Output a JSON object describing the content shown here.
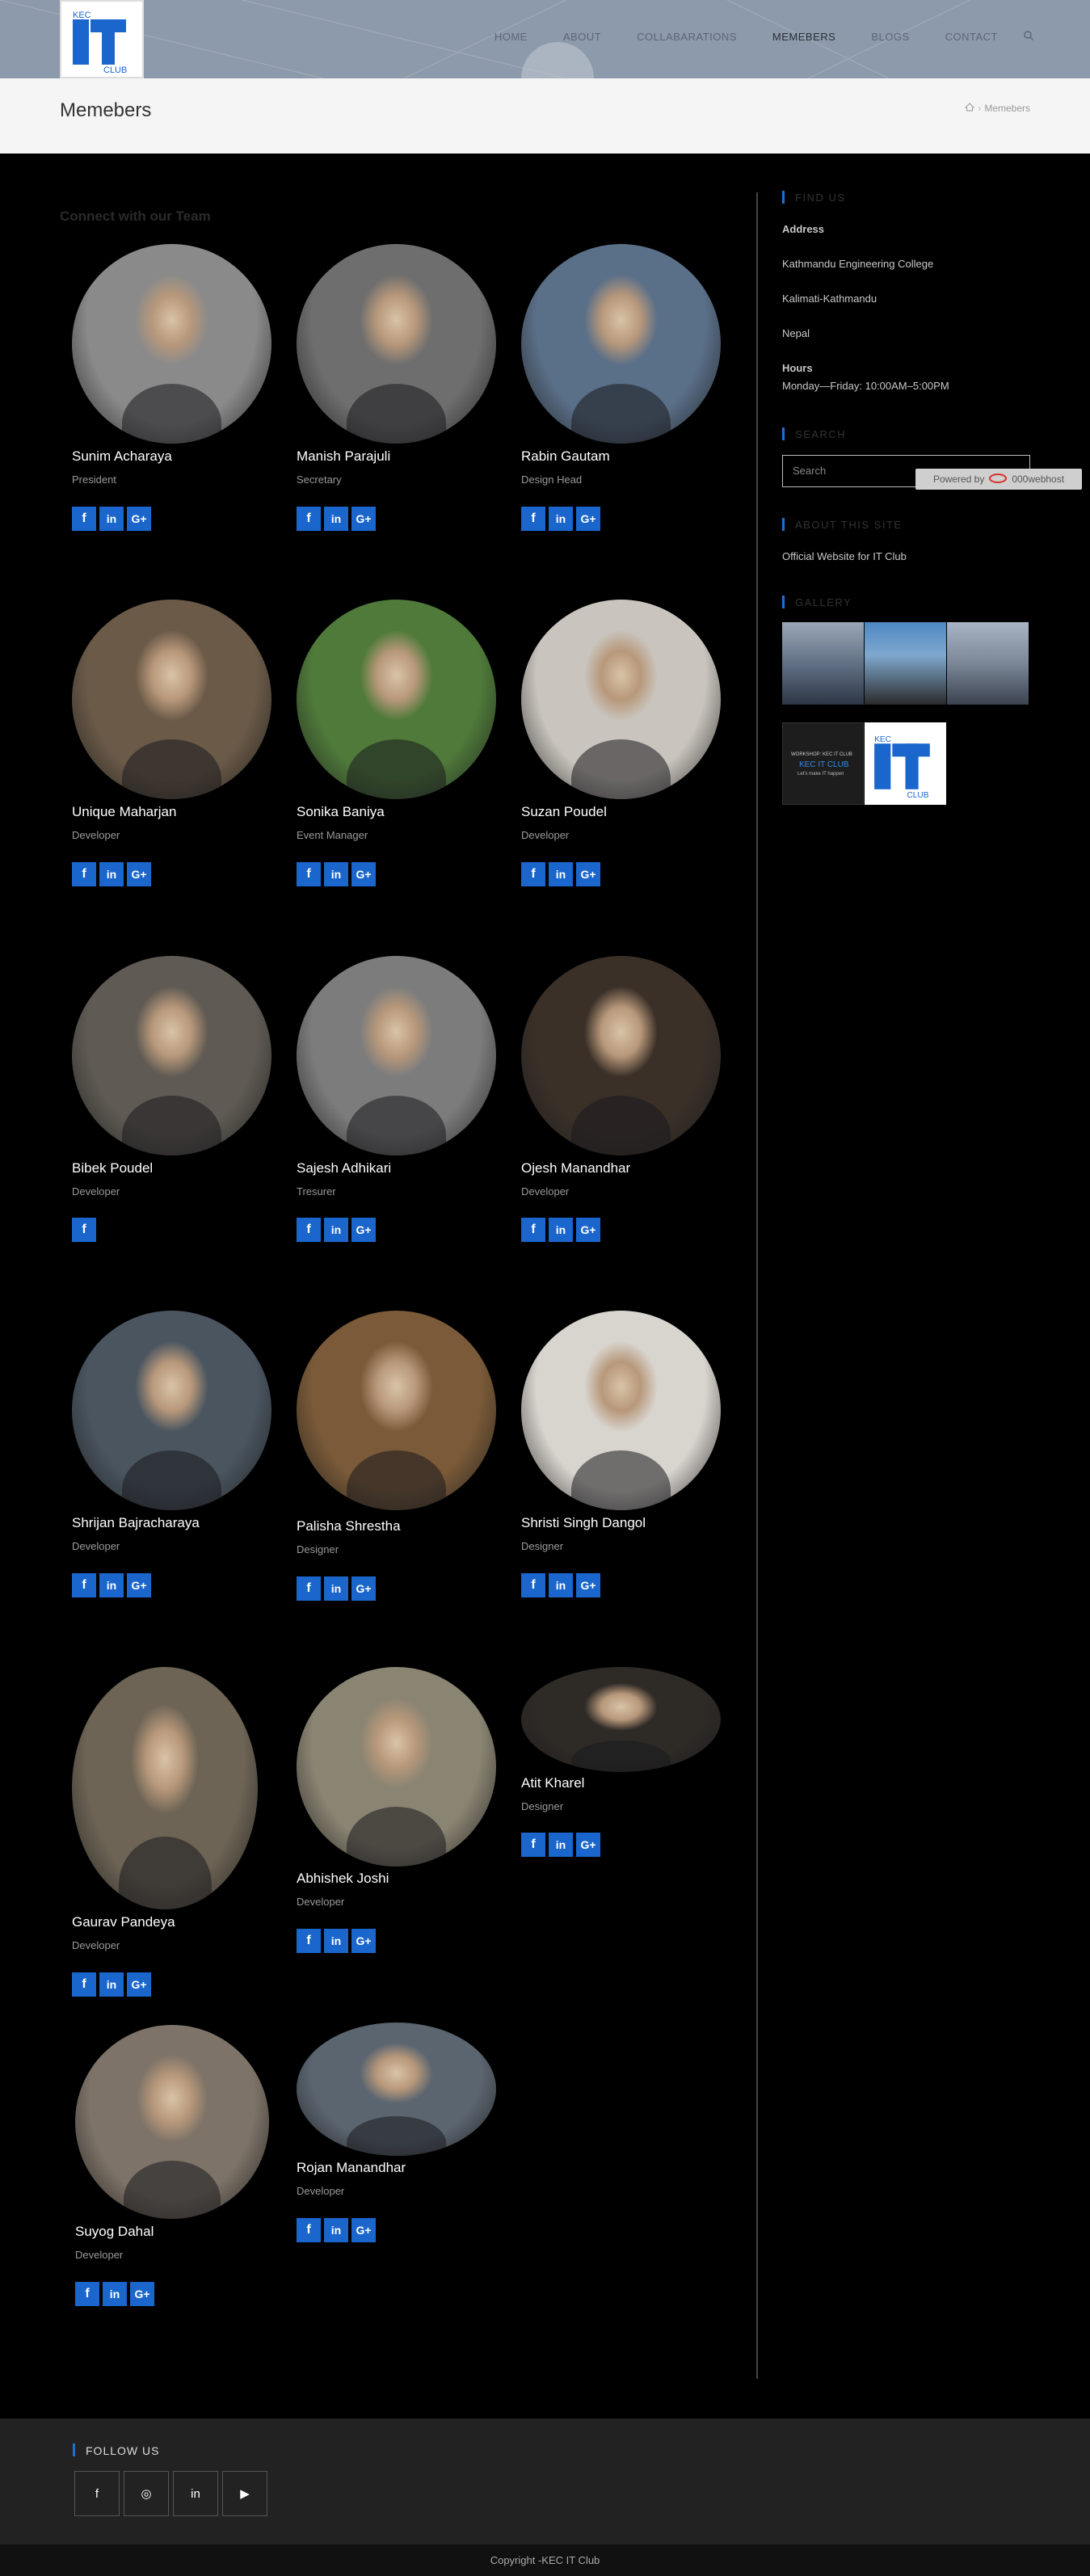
{
  "header": {
    "logo": {
      "top": "KEC",
      "main": "IT",
      "bottom": "CLUB"
    },
    "nav": [
      "HOME",
      "ABOUT",
      "COLLABARATIONS",
      "MEMEBERS",
      "BLOGS",
      "CONTACT"
    ],
    "active": "MEMEBERS"
  },
  "page": {
    "title": "Memebers",
    "breadcrumb_current": "Memebers",
    "team_heading": "Connect with our Team"
  },
  "members": [
    {
      "name": "Sunim Acharaya",
      "role": "President",
      "socials": [
        "f",
        "in",
        "G+"
      ],
      "color": "#8a8a8a"
    },
    {
      "name": "Manish Parajuli",
      "role": "Secretary",
      "socials": [
        "f",
        "in",
        "G+"
      ],
      "color": "#6e6e6e"
    },
    {
      "name": "Rabin Gautam",
      "role": "Design Head",
      "socials": [
        "f",
        "in",
        "G+"
      ],
      "color": "#5a6f88"
    },
    {
      "name": "Unique Maharjan",
      "role": "Developer",
      "socials": [
        "f",
        "in",
        "G+"
      ],
      "color": "#6b5a48"
    },
    {
      "name": "Sonika Baniya",
      "role": "Event Manager",
      "socials": [
        "f",
        "in",
        "G+"
      ],
      "color": "#4f7a3a"
    },
    {
      "name": "Suzan Poudel",
      "role": "Developer",
      "socials": [
        "f",
        "in",
        "G+"
      ],
      "color": "#c9c4bd"
    },
    {
      "name": "Bibek Poudel",
      "role": "Developer",
      "socials": [
        "f"
      ],
      "color": "#5f5a53"
    },
    {
      "name": "Sajesh Adhikari",
      "role": "Tresurer",
      "socials": [
        "f",
        "in",
        "G+"
      ],
      "color": "#7c7c7c"
    },
    {
      "name": "Ojesh Manandhar",
      "role": "Developer",
      "socials": [
        "f",
        "in",
        "G+"
      ],
      "color": "#3a3028"
    },
    {
      "name": "Shrijan Bajracharaya",
      "role": "Developer",
      "socials": [
        "f",
        "in",
        "G+"
      ],
      "color": "#4a5560"
    },
    {
      "name": "Palisha Shrestha",
      "role": "Designer",
      "socials": [
        "f",
        "in",
        "G+"
      ],
      "color": "#7a5a38"
    },
    {
      "name": "Shristi Singh Dangol",
      "role": "Designer",
      "socials": [
        "f",
        "in",
        "G+"
      ],
      "color": "#d8d4ce"
    },
    {
      "name": "Gaurav Pandeya",
      "role": "Developer",
      "socials": [
        "f",
        "in",
        "G+"
      ],
      "color": "#6d6455"
    },
    {
      "name": "Abhishek Joshi",
      "role": "Developer",
      "socials": [
        "f",
        "in",
        "G+"
      ],
      "color": "#8a8472"
    },
    {
      "name": "Atit Kharel",
      "role": "Designer",
      "socials": [
        "f",
        "in",
        "G+"
      ],
      "color": "#2e2a26"
    },
    {
      "name": "Suyog Dahal",
      "role": "Developer",
      "socials": [
        "f",
        "in",
        "G+"
      ],
      "color": "#7d7368"
    },
    {
      "name": "Rojan Manandhar",
      "role": "Developer",
      "socials": [
        "f",
        "in",
        "G+"
      ],
      "color": "#5b6570"
    }
  ],
  "sidebar": {
    "find_us_title": "FIND US",
    "address_label": "Address",
    "address_lines": [
      "Kathmandu Engineering College",
      "Kalimati-Kathmandu",
      "Nepal"
    ],
    "hours_label": "Hours",
    "hours_value": "Monday—Friday: 10:00AM–5:00PM",
    "search_title": "SEARCH",
    "search_placeholder": "Search",
    "powered_by": "Powered by",
    "host_name": "000webhost",
    "about_title": "ABOUT THIS SITE",
    "about_text": "Official Website for IT Club",
    "gallery_title": "GALLERY",
    "gallery_banner_line1": "WORKSHOP: KEC IT CLUB",
    "gallery_banner_line2": "KEC IT CLUB",
    "gallery_banner_line3": "Let's make IT happen",
    "gallery_logo": {
      "top": "KEC",
      "main": "IT",
      "bottom": "CLUB"
    }
  },
  "footer": {
    "follow_title": "FOLLOW US",
    "socials": [
      "f",
      "◎",
      "in",
      "▶"
    ],
    "copyright": "Copyright -KEC IT Club"
  },
  "colors": {
    "accent": "#1e6fd1",
    "social": "#1a66cc",
    "header_bg": "#8d9aab"
  }
}
